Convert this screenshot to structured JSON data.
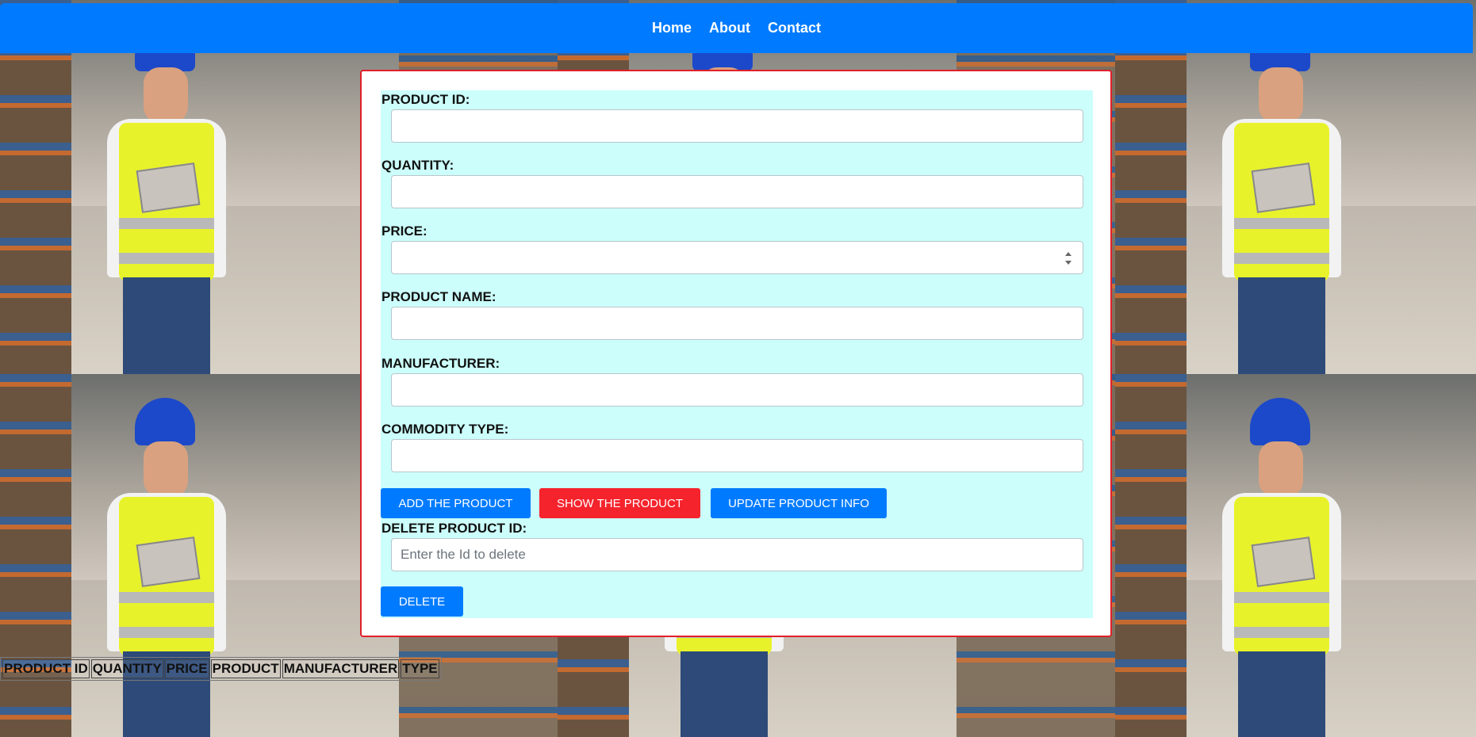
{
  "nav": {
    "links": [
      "Home",
      "About",
      "Contact"
    ]
  },
  "form": {
    "product_id_label": "PRODUCT ID:",
    "quantity_label": "QUANTITY:",
    "price_label": "PRICE:",
    "product_name_label": "PRODUCT NAME:",
    "manufacturer_label": "MANUFACTURER:",
    "commodity_type_label": "COMMODITY TYPE:",
    "add_button": "ADD THE PRODUCT",
    "show_button": "SHOW THE PRODUCT",
    "update_button": "UPDATE PRODUCT INFO",
    "delete_id_label": "DELETE PRODUCT ID:",
    "delete_placeholder": "Enter the Id to delete",
    "delete_button": "DELETE"
  },
  "table": {
    "headers": [
      "PRODUCT ID",
      "QUANTITY",
      "PRICE",
      "PRODUCT",
      "MANUFACTURER",
      "TYPE"
    ]
  },
  "colors": {
    "nav": "#007bff",
    "form_bg": "#ccfffb",
    "card_border": "#e0202a",
    "show_button": "#f5232c"
  }
}
